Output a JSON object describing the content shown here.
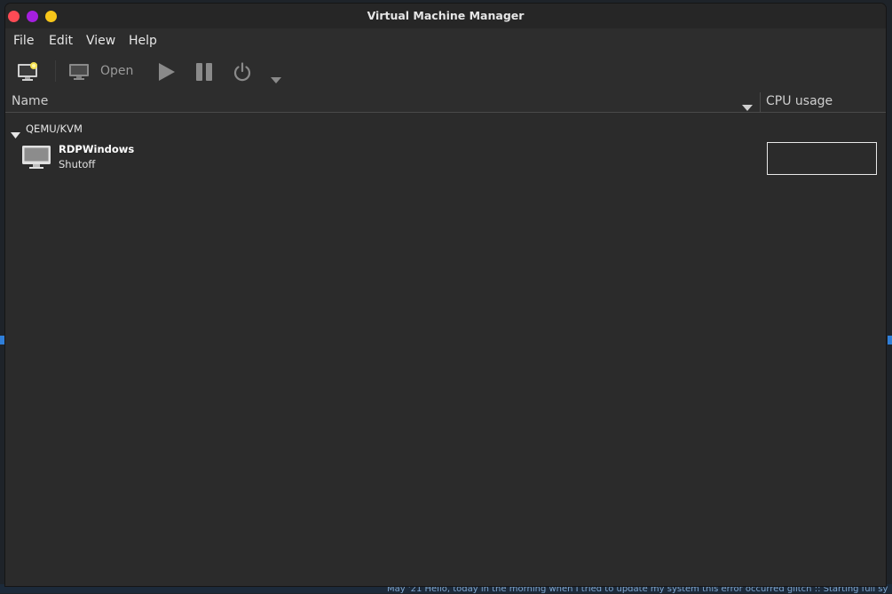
{
  "window": {
    "title": "Virtual Machine Manager"
  },
  "menu": {
    "file": "File",
    "edit": "Edit",
    "view": "View",
    "help": "Help"
  },
  "toolbar": {
    "open_label": "Open"
  },
  "columns": {
    "name": "Name",
    "cpu": "CPU usage"
  },
  "group": {
    "label": "QEMU/KVM"
  },
  "vms": [
    {
      "name": "RDPWindows",
      "status": "Shutoff"
    }
  ],
  "background": {
    "snippet": "May '21    Hello, today in the morning when I tried to update my system this error occurred glitch :: Starting full sy"
  },
  "colors": {
    "window_bg": "#2b2b2b",
    "close": "#ff4b55",
    "minimize": "#a51fdf",
    "maximize": "#f7c61a"
  }
}
